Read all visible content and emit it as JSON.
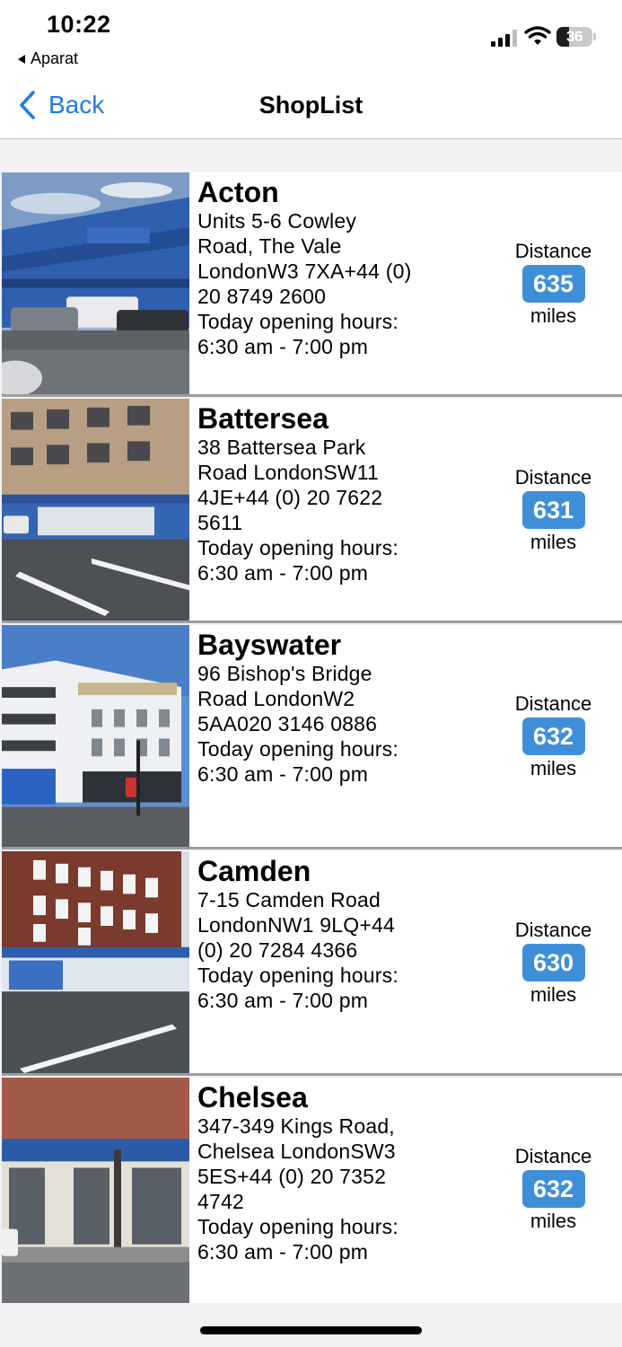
{
  "status": {
    "time": "10:22",
    "back_app": "Aparat",
    "battery": "36",
    "battery_level": 0.36
  },
  "nav": {
    "back_label": "Back",
    "title": "ShopList"
  },
  "distance_label": "Distance",
  "miles_label": "miles",
  "shops": [
    {
      "name": "Acton",
      "address": "Units 5-6 Cowley\nRoad, The Vale\nLondonW3 7XA+44 (0)\n20 8749 2600",
      "hours_label": "Today opening hours:",
      "hours": "6:30 am - 7:00 pm",
      "distance": "635"
    },
    {
      "name": "Battersea",
      "address": "38 Battersea Park\nRoad LondonSW11\n4JE+44 (0) 20 7622\n5611",
      "hours_label": "Today opening hours:",
      "hours": "6:30 am - 7:00 pm",
      "distance": "631"
    },
    {
      "name": "Bayswater",
      "address": "96 Bishop's Bridge\nRoad LondonW2\n5AA020 3146 0886",
      "hours_label": "Today opening hours:",
      "hours": "6:30 am - 7:00 pm",
      "distance": "632"
    },
    {
      "name": "Camden",
      "address": "7-15 Camden Road\nLondonNW1 9LQ+44\n(0) 20 7284 4366",
      "hours_label": "Today opening hours:",
      "hours": "6:30 am - 7:00 pm",
      "distance": "630"
    },
    {
      "name": "Chelsea",
      "address": "347-349 Kings Road,\nChelsea LondonSW3\n5ES+44 (0) 20 7352\n4742",
      "hours_label": "Today opening hours:",
      "hours": "6:30 am - 7:00 pm",
      "distance": "632"
    }
  ]
}
